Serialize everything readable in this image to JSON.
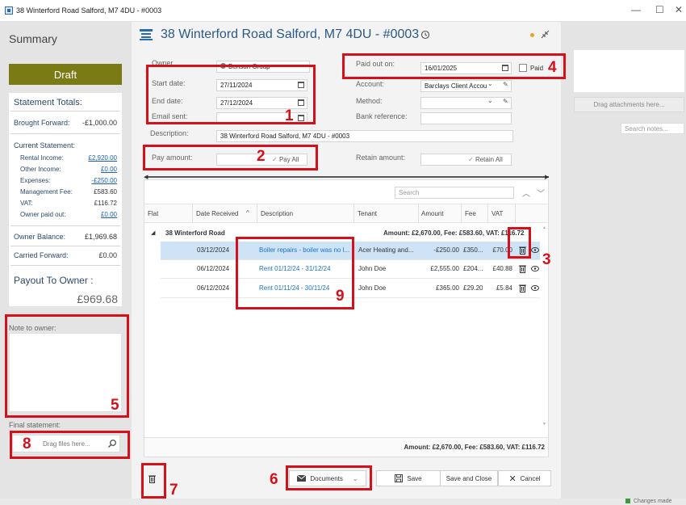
{
  "window": {
    "title": "38 Winterford Road Salford, M7 4DU - #0003",
    "minimize": "—",
    "maximize": "☐",
    "close": "✕"
  },
  "summary": {
    "heading": "Summary",
    "status_button": "Draft",
    "totals_title": "Statement Totals:",
    "brought_forward": {
      "label": "Brought Forward:",
      "value": "-£1,000.00"
    },
    "current_statement_label": "Current Statement:",
    "rental_income": {
      "label": "Rental Income:",
      "value": "£2,920.00"
    },
    "other_income": {
      "label": "Other Income:",
      "value": "£0.00"
    },
    "expenses": {
      "label": "Expenses:",
      "value": "-£250.00"
    },
    "management_fee": {
      "label": "Management Fee:",
      "value": "£583.60"
    },
    "vat": {
      "label": "VAT:",
      "value": "£116.72"
    },
    "owner_paid_out": {
      "label": "Owner paid out:",
      "value": "£0.00"
    },
    "owner_balance": {
      "label": "Owner Balance:",
      "value": "£1,969.68"
    },
    "carried_forward": {
      "label": "Carried Forward:",
      "value": "£0.00"
    },
    "payout_label": "Payout To Owner :",
    "payout_value": "£969.68",
    "note_label": "Note to owner:",
    "final_label": "Final statement:",
    "drag_files": "Drag files here..."
  },
  "form": {
    "title": "38 Winterford Road Salford, M7 4DU - #0003",
    "owner_label": "Owner",
    "owner_value": "Benson Group",
    "start_label": "Start date:",
    "start_value": "27/11/2024",
    "end_label": "End date:",
    "end_value": "27/12/2024",
    "email_label": "Email sent:",
    "description_label": "Description:",
    "description_value": "38 Winterford Road Salford, M7 4DU - #0003",
    "paid_out_label": "Paid out on:",
    "paid_out_value": "16/01/2025",
    "paid_label": "Paid",
    "account_label": "Account:",
    "account_value": "Barclays Client Accou",
    "method_label": "Method:",
    "bankref_label": "Bank reference:",
    "pay_amount_label": "Pay amount:",
    "pay_all": "Pay All",
    "retain_label": "Retain amount:",
    "retain_all": "Retain All"
  },
  "grid": {
    "search_placeholder": "Search",
    "columns": [
      "Flat",
      "Date Received",
      "Description",
      "Tenant",
      "Amount",
      "Fee",
      "VAT"
    ],
    "group": {
      "name": "38 Winterford Road",
      "summary": "Amount: £2,670.00,   Fee: £583.60,   VAT: £116.72"
    },
    "rows": [
      {
        "date": "03/12/2024",
        "description": "Boiler repairs - boiler was no l...",
        "tenant": "Acer Heating and...",
        "amount": "-£250.00",
        "fee": "£350...",
        "vat": "£70.00"
      },
      {
        "date": "06/12/2024",
        "description": "Rent 01/12/24 - 31/12/24",
        "tenant": "John Doe",
        "amount": "£2,555.00",
        "fee": "£204...",
        "vat": "£40.88"
      },
      {
        "date": "06/12/2024",
        "description": "Rent 01/11/24 - 30/11/24",
        "tenant": "John Doe",
        "amount": "£365.00",
        "fee": "£29.20",
        "vat": "£5.84"
      }
    ],
    "footer": "Amount: £2,670.00,  Fee: £583.60,  VAT: £116.72"
  },
  "actions": {
    "documents": "Documents",
    "save": "Save",
    "save_close": "Save and Close",
    "cancel": "Cancel"
  },
  "attachments": {
    "drag": "Drag attachments here...",
    "search_notes": "Search notes..."
  },
  "annotations": [
    "1",
    "2",
    "3",
    "4",
    "5",
    "6",
    "7",
    "8",
    "9"
  ],
  "status": {
    "text": "Changes made"
  }
}
